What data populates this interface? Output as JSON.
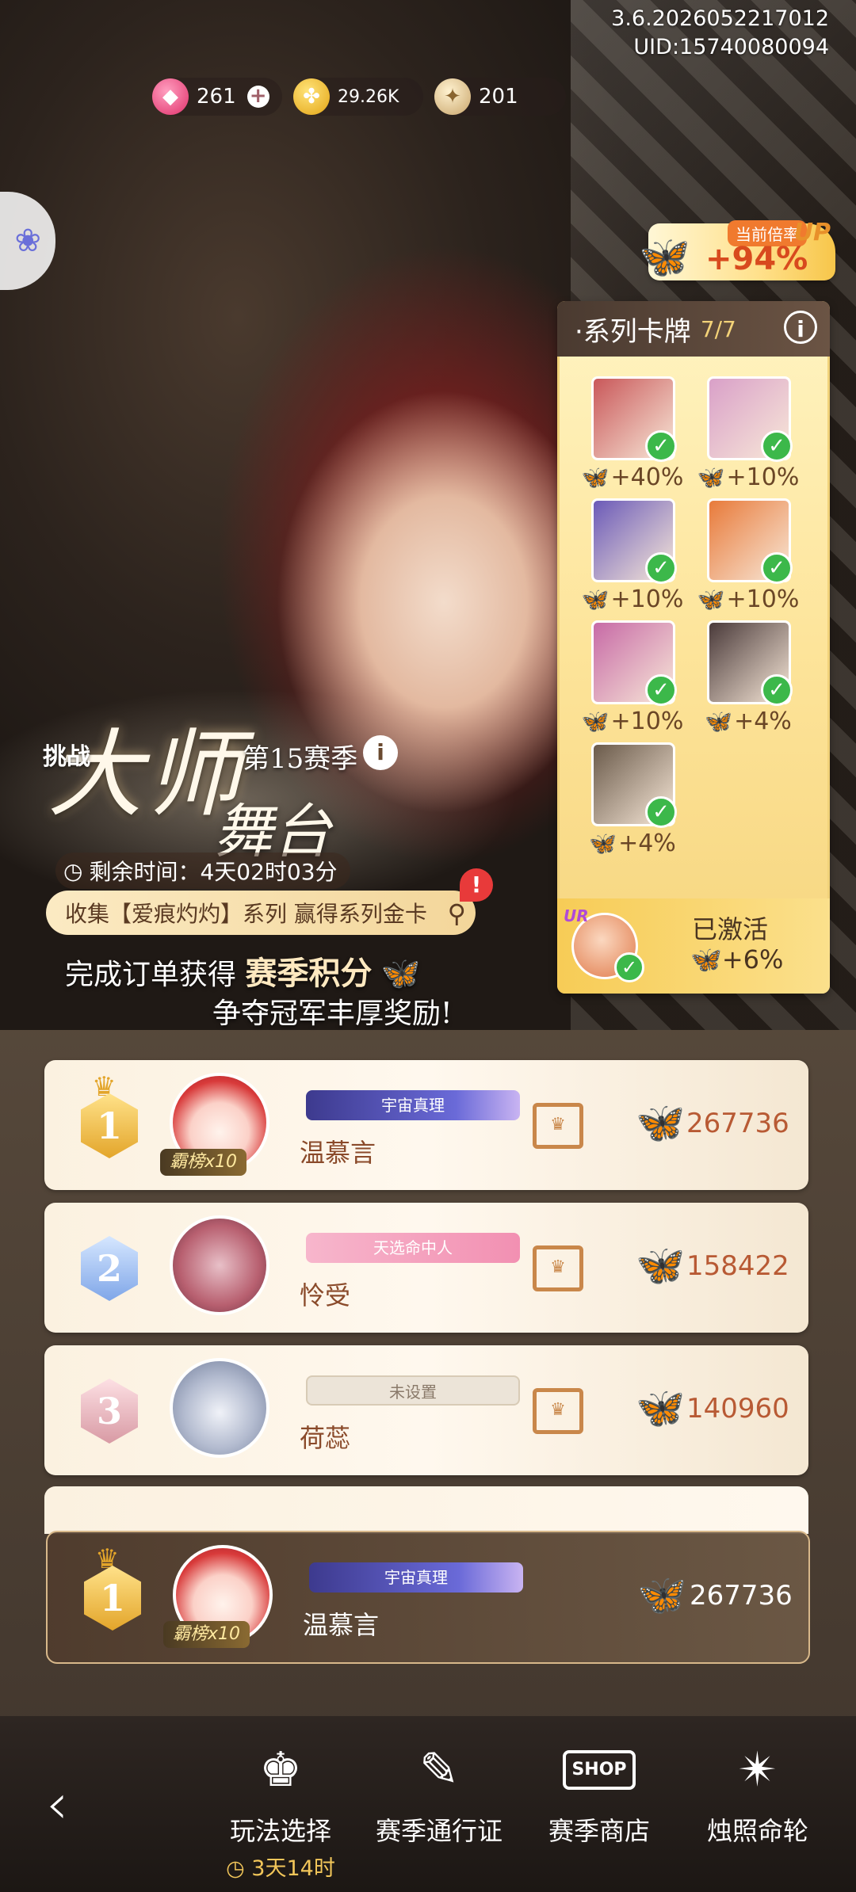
{
  "status": {
    "version": "3.6.2026052217012",
    "uid": "UID:15740080094"
  },
  "currency": {
    "gems": "261",
    "coins": "29.26K",
    "stars": "201"
  },
  "multiplier": {
    "label": "当前倍率",
    "value": "+94%",
    "up": "UP"
  },
  "series": {
    "title": "·系列卡牌",
    "count": "7/7",
    "cards": [
      {
        "bonus": "+40%",
        "color": "#c9585a"
      },
      {
        "bonus": "+10%",
        "color": "#d9a0c8"
      },
      {
        "bonus": "+10%",
        "color": "#6b5ab8"
      },
      {
        "bonus": "+10%",
        "color": "#e87a3a"
      },
      {
        "bonus": "+10%",
        "color": "#c76aa6"
      },
      {
        "bonus": "+4%",
        "color": "#4a3a3a"
      },
      {
        "bonus": "+4%",
        "color": "#6a5a4a"
      }
    ],
    "footer": {
      "tag": "UR",
      "status": "已激活",
      "bonus": "+6%"
    }
  },
  "challenge": {
    "tag": "挑战",
    "title_main": "大师",
    "title_sub": "舞台",
    "season": "第15赛季",
    "remaining": "剩余时间：4天02时03分",
    "collect": "收集【爱痕灼灼】系列 赢得系列金卡",
    "order_prefix": "完成订单获得",
    "order_bold": "赛季积分",
    "prize": "争夺冠军丰厚奖励!"
  },
  "leaderboard": [
    {
      "rank": "1",
      "name": "温慕言",
      "title": "宇宙真理",
      "badge": "霸榜x10",
      "score": "267736"
    },
    {
      "rank": "2",
      "name": "怜受",
      "title": "天选命中人",
      "badge": "",
      "score": "158422"
    },
    {
      "rank": "3",
      "name": "荷蕊",
      "title": "未设置",
      "badge": "",
      "score": "140960"
    }
  ],
  "my_rank": {
    "rank": "1",
    "name": "温慕言",
    "title": "宇宙真理",
    "badge": "霸榜x10",
    "score": "267736"
  },
  "nav": {
    "mode": "玩法选择",
    "mode_sub": "3天14时",
    "pass": "赛季通行证",
    "shop": "赛季商店",
    "shop_sign": "SHOP",
    "wheel": "烛照命轮"
  }
}
